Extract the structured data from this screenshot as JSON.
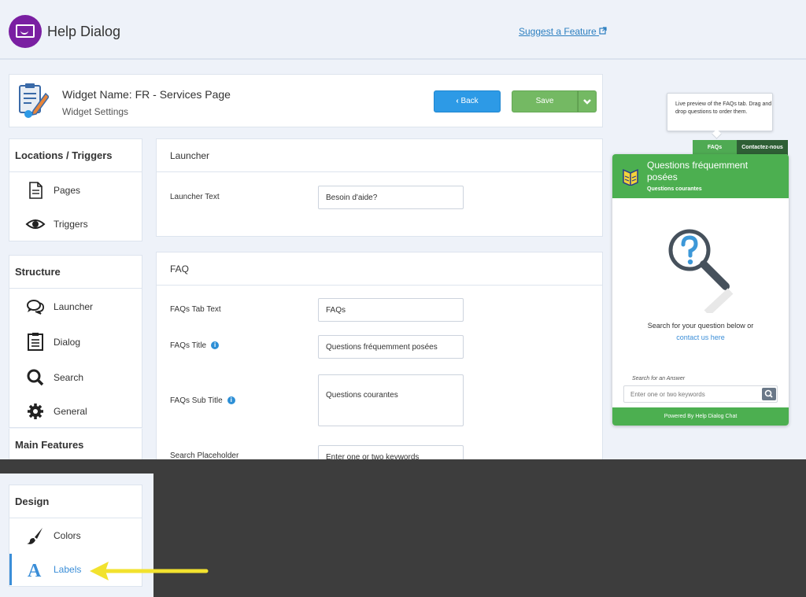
{
  "app": {
    "title": "Help Dialog",
    "suggest_link": "Suggest a Feature"
  },
  "widget": {
    "name": "Widget Name: FR - Services Page",
    "subtitle": "Widget Settings",
    "back_label": "Back",
    "save_label": "Save"
  },
  "nav": {
    "locations": {
      "title": "Locations / Triggers",
      "items": [
        "Pages",
        "Triggers"
      ]
    },
    "structure": {
      "title": "Structure",
      "items": [
        "Launcher",
        "Dialog",
        "Search",
        "General"
      ]
    },
    "main_features": {
      "title": "Main Features"
    },
    "design": {
      "title": "Design",
      "items": [
        "Colors",
        "Labels"
      ],
      "active": "Labels"
    }
  },
  "launcher": {
    "title": "Launcher",
    "text_label": "Launcher Text",
    "text_value": "Besoin d'aide?"
  },
  "faq": {
    "title": "FAQ",
    "tab_text_label": "FAQs Tab Text",
    "tab_text_value": "FAQs",
    "title_label": "FAQs Title",
    "title_value": "Questions fréquemment posées",
    "subtitle_label": "FAQs Sub Title",
    "subtitle_value": "Questions courantes",
    "placeholder_label": "Search Placeholder",
    "placeholder_value": "Enter one or two keywords"
  },
  "preview": {
    "tooltip": "Live preview of the FAQs tab. Drag and drop questions to order them.",
    "tab_faqs": "FAQs",
    "tab_contact": "Contactez-nous",
    "title": "Questions fréquemment posées",
    "subtitle": "Questions courantes",
    "body_text": "Search for your question below or",
    "contact_link": "contact us here",
    "search_label": "Search for an Answer",
    "search_placeholder": "Enter one or two keywords",
    "footer": "Powered By  Help Dialog Chat"
  },
  "colors": {
    "accent_green": "#4caf50",
    "accent_blue": "#2d9ae6",
    "brand_purple": "#7a1fa2",
    "overlay": "#3d3d3d",
    "arrow": "#f2e22e"
  }
}
